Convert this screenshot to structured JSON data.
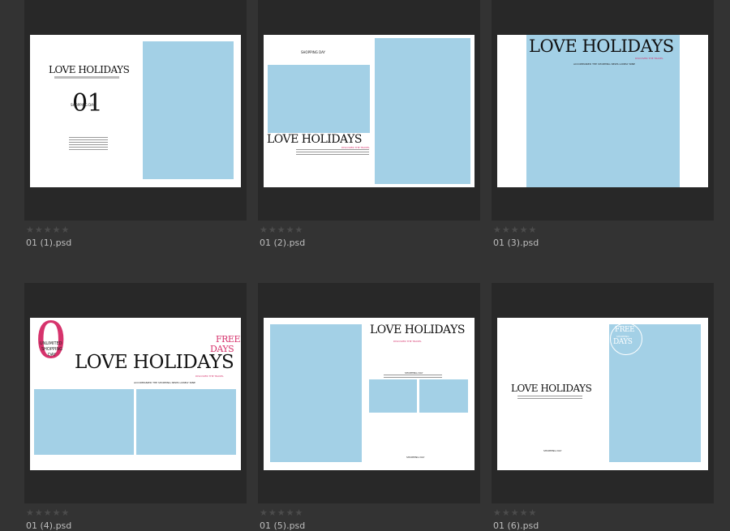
{
  "star_glyph": "★★★★★",
  "thumbnails": [
    {
      "file_name": "01 (1).psd",
      "title": "LOVE HOLIDAYS",
      "number": "01",
      "number_label": "SHOPPING DAY"
    },
    {
      "file_name": "01 (2).psd",
      "title": "LOVE HOLIDAYS",
      "header": "SHOPPING DAY",
      "accent": "DISCOVER THE TRAVEL"
    },
    {
      "file_name": "01 (3).psd",
      "title": "LOVE HOLIDAYS",
      "accent": "DISCOVER THE TRAVEL",
      "tagline": "ACCOMPANIED THE SHOPPING NEWS LONELY NINE"
    },
    {
      "file_name": "01 (4).psd",
      "title": "LOVE HOLIDAYS",
      "big_letter": "0",
      "side_line1": "UNLIMITED",
      "side_line2": "SHOPPING",
      "side_line3": "DAY",
      "free_word": "FREE",
      "days_word": "DAYS",
      "accent": "DISCOVER THE TRAVEL",
      "tagline": "ACCOMPANIED THE SHOPPING NEWS LONELY NINE"
    },
    {
      "file_name": "01 (5).psd",
      "title": "LOVE HOLIDAYS",
      "accent": "DISCOVER THE TRAVEL",
      "mid_text": "SHOPPING DAY",
      "footer": "SHOPPING DAY"
    },
    {
      "file_name": "01 (6).psd",
      "title": "LOVE HOLIDAYS",
      "badge_line1": "FREE",
      "badge_line2": "SHOPPING",
      "badge_line3": "DAYS",
      "footer": "SHOPPING DAY"
    }
  ],
  "colors": {
    "background": "#333333",
    "tile": "#282828",
    "page": "#ffffff",
    "photo_placeholder": "#a3d0e6",
    "accent_pink": "#d6336c"
  }
}
